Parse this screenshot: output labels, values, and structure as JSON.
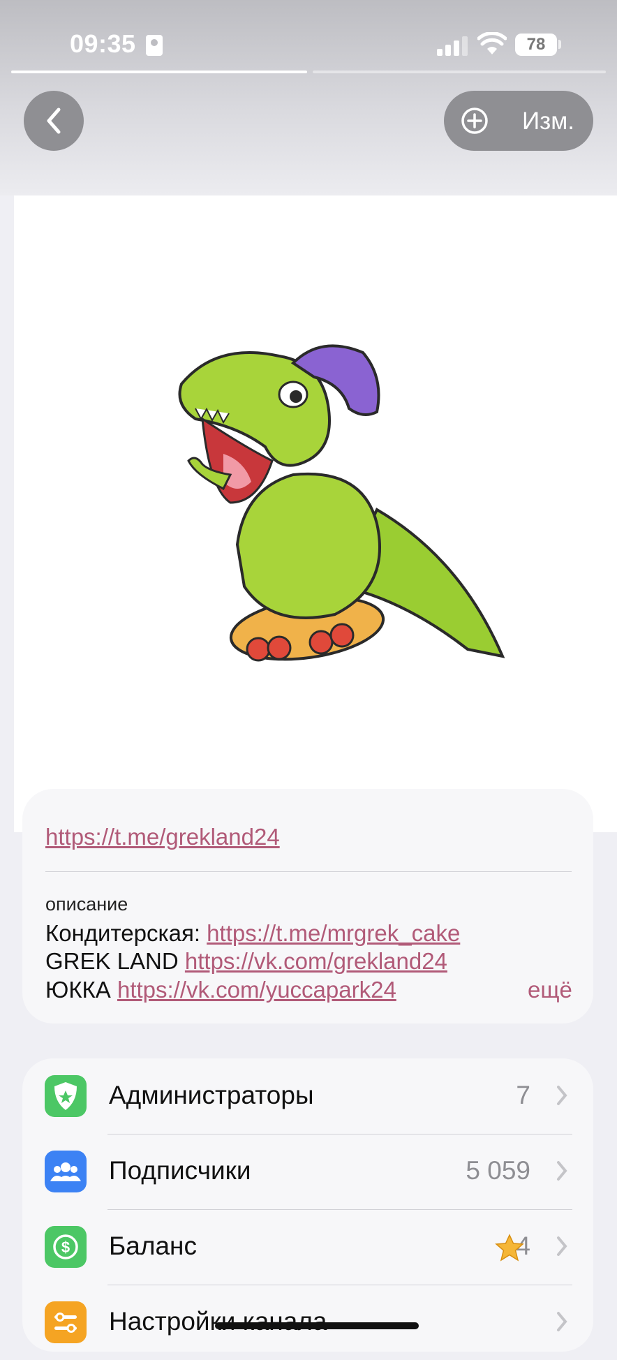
{
  "status_bar": {
    "time": "09:35",
    "battery": "78"
  },
  "nav": {
    "edit_label": "Изм."
  },
  "info": {
    "link_partial": "https://t.me/grekland24",
    "description_label": "описание",
    "desc_lines": [
      {
        "prefix": "Кондитерская: ",
        "link": "https://t.me/mrgrek_cake"
      },
      {
        "prefix": "GREK LAND ",
        "link": "https://vk.com/grekland24"
      },
      {
        "prefix": "ЮККА ",
        "link": "https://vk.com/yuccapark24"
      }
    ],
    "more_label": "ещё"
  },
  "menu": {
    "items": [
      {
        "label": "Администраторы",
        "value": "7",
        "icon": "shield-star-icon",
        "color": "#4cc765"
      },
      {
        "label": "Подписчики",
        "value": "5 059",
        "icon": "people-icon",
        "color": "#3c82f4"
      },
      {
        "label": "Баланс",
        "value": "4",
        "icon": "dollar-icon",
        "color": "#4cc765"
      },
      {
        "label": "Настройки канала",
        "value": "",
        "icon": "settings-icon",
        "color": "#f5a423"
      }
    ]
  },
  "colors": {
    "link": "#b15a78",
    "card": "#f7f7f9",
    "background": "#efeff4"
  }
}
